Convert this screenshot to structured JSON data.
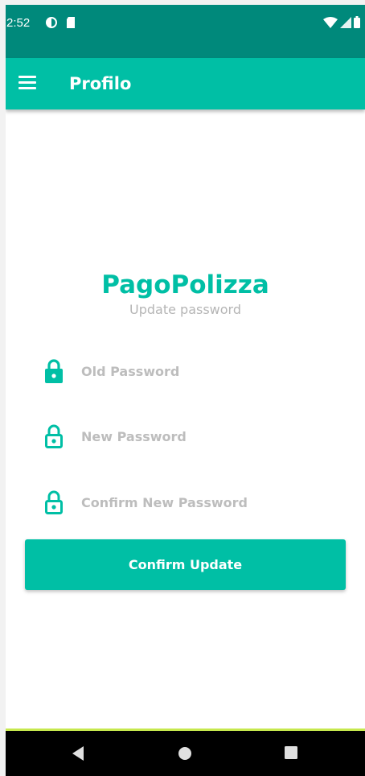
{
  "status_bar": {
    "time": "2:52",
    "left_icons": [
      "notification-icon",
      "sd-card-icon"
    ],
    "right_icons": [
      "wifi-icon",
      "signal-icon",
      "battery-icon"
    ]
  },
  "app_bar": {
    "title": "Profilo",
    "menu_icon": "menu-icon"
  },
  "header": {
    "brand": "PagoPolizza",
    "subtitle": "Update password"
  },
  "form": {
    "old_password": {
      "placeholder": "Old Password",
      "value": ""
    },
    "new_password": {
      "placeholder": "New Password",
      "value": ""
    },
    "confirm_password": {
      "placeholder": "Confirm New Password",
      "value": ""
    },
    "submit_label": "Confirm Update"
  },
  "nav_bar": [
    "back-icon",
    "home-icon",
    "recents-icon"
  ],
  "colors": {
    "primary": "#00bfa5",
    "primary_dark": "#00897b",
    "placeholder": "#bdbdbd"
  }
}
